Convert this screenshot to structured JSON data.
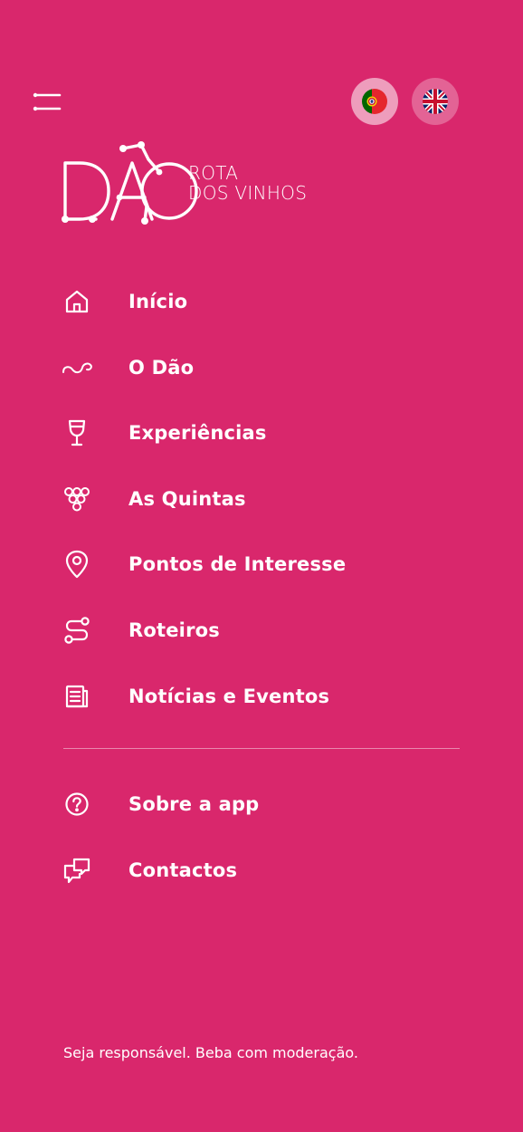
{
  "app": {
    "logo_mark": "DÃO",
    "logo_line1": "ROTA",
    "logo_line2": "DOS VINHOS"
  },
  "header": {
    "languages": [
      {
        "code": "pt",
        "flag": "portugal-flag-icon",
        "selected": true
      },
      {
        "code": "en",
        "flag": "uk-flag-icon",
        "selected": false
      }
    ]
  },
  "menu": {
    "primary": [
      {
        "label": "Início",
        "icon": "home-icon"
      },
      {
        "label": "O Dão",
        "icon": "river-icon"
      },
      {
        "label": "Experiências",
        "icon": "wine-glass-icon"
      },
      {
        "label": "As Quintas",
        "icon": "grapes-icon"
      },
      {
        "label": "Pontos de Interesse",
        "icon": "map-pin-icon"
      },
      {
        "label": "Roteiros",
        "icon": "route-icon"
      },
      {
        "label": "Notícias e Eventos",
        "icon": "news-icon"
      }
    ],
    "secondary": [
      {
        "label": "Sobre a app",
        "icon": "help-circle-icon"
      },
      {
        "label": "Contactos",
        "icon": "chat-icon"
      }
    ]
  },
  "footer": {
    "disclaimer": "Seja responsável. Beba com moderação."
  },
  "colors": {
    "background": "#D9276C",
    "foreground": "#FFFFFF"
  }
}
